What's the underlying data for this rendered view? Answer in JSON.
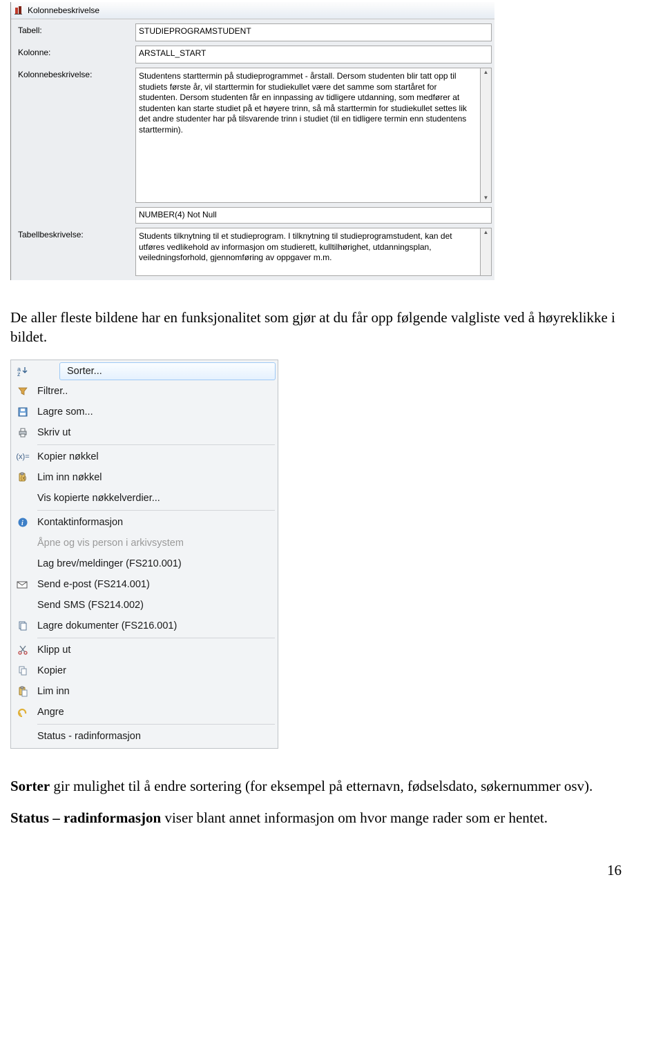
{
  "dialog": {
    "title": "Kolonnebeskrivelse",
    "labels": {
      "tabell": "Tabell:",
      "kolonne": "Kolonne:",
      "kolonnebeskrivelse": "Kolonnebeskrivelse:",
      "tabellbeskrivelse": "Tabellbeskrivelse:"
    },
    "values": {
      "tabell": "STUDIEPROGRAMSTUDENT",
      "kolonne": "ARSTALL_START",
      "kolonnebeskrivelse": "Studentens starttermin på studieprogrammet - årstall. Dersom studenten blir tatt opp til studiets første år, vil starttermin for studiekullet være det samme som startåret for studenten. Dersom studenten får en innpassing av tidligere utdanning, som medfører at studenten kan starte studiet på et høyere trinn, så må starttermin for studiekullet settes lik det andre studenter har på tilsvarende trinn i studiet (til en tidligere termin enn studentens starttermin).",
      "datatype": "NUMBER(4) Not Null",
      "tabellbeskrivelse": "Students tilknytning til et studieprogram.  I tilknytning til studieprogramstudent, kan det utføres vedlikehold av informasjon om studierett, kulltilhørighet, utdanningsplan, veiledningsforhold, gjennomføring av oppgaver m.m."
    }
  },
  "para1a": "De aller fleste bildene har en funksjonalitet som gjør at du får opp følgende valgliste ved å høyreklikke i bildet.",
  "menu": {
    "items": [
      "Sorter...",
      "Filtrer..",
      "Lagre som...",
      "Skriv ut",
      "Kopier nøkkel",
      "Lim inn nøkkel",
      "Vis kopierte nøkkelverdier...",
      "Kontaktinformasjon",
      "Åpne og vis person i arkivsystem",
      "Lag brev/meldinger (FS210.001)",
      "Send e-post (FS214.001)",
      "Send SMS (FS214.002)",
      "Lagre dokumenter (FS216.001)",
      "Klipp ut",
      "Kopier",
      "Lim inn",
      "Angre",
      "Status - radinformasjon"
    ]
  },
  "para2_bold": "Sorter",
  "para2_rest": " gir mulighet til å endre sortering (for eksempel på etternavn, fødselsdato, søkernummer osv).",
  "para3_bold": "Status – radinformasjon",
  "para3_rest": " viser blant annet informasjon om hvor mange rader som er hentet.",
  "page_number": "16"
}
